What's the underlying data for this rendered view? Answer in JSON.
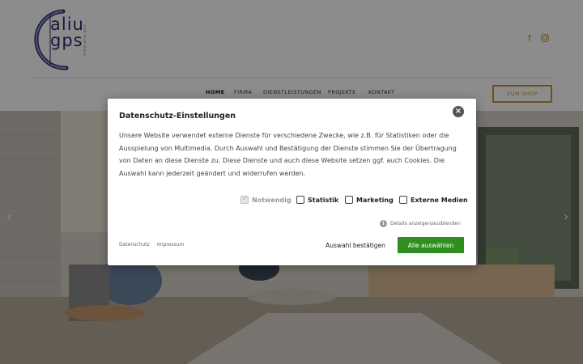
{
  "logo": {
    "letters_top": "aliu",
    "letters_bottom": "gps",
    "sub": "www.aliu.gps"
  },
  "social": {
    "facebook_icon": "facebook-icon",
    "instagram_icon": "instagram-icon"
  },
  "nav": {
    "items": [
      "HOME",
      "FIRMA",
      "DIENSTLEISTUNGEN",
      "PROJEKTE",
      "KONTAKT"
    ],
    "active_index": 0
  },
  "shop_button": "ZUM SHOP",
  "colors": {
    "accent_gold": "#c9942b",
    "logo_navy": "#2a2f75",
    "button_green": "#2f8f1e"
  },
  "modal": {
    "title": "Datenschutz-Einstellungen",
    "text": "Unsere Website verwendet externe Dienste für verschiedene Zwecke, wie z.B. für Statistiken oder die Ausspielung von Multimedia. Durch Auswahl und Bestätigung der Dienste stimmen Sie der Übertragung von Daten an diese Dienste zu. Diese Dienste und auch diese Website setzen ggf. auch Cookies. Die Auswahl kann jederzeit geändert und widerrufen werden.",
    "options": [
      {
        "label": "Notwendig",
        "checked": true,
        "disabled": true
      },
      {
        "label": "Statistik",
        "checked": false,
        "disabled": false
      },
      {
        "label": "Marketing",
        "checked": false,
        "disabled": false
      },
      {
        "label": "Externe Medien",
        "checked": false,
        "disabled": false
      }
    ],
    "details_link": "Details anzeigen/ausblenden",
    "footer_links": [
      "Datenschutz",
      "Impressum"
    ],
    "confirm_button": "Auswahl bestätigen",
    "accept_all_button": "Alle auswählen",
    "close_icon": "close-icon"
  }
}
